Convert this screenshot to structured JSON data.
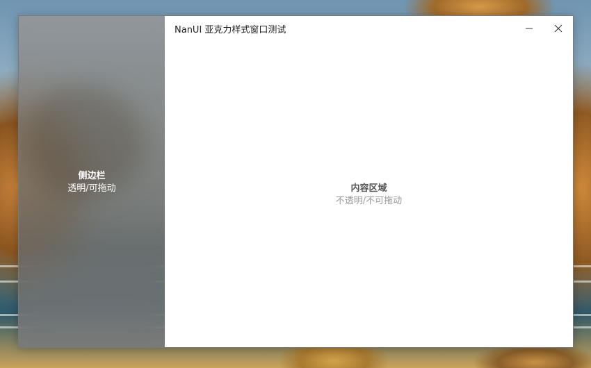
{
  "window": {
    "title": "NanUI 亚克力样式窗口测试",
    "minimize_icon": "minimize-icon",
    "close_icon": "close-icon"
  },
  "sidebar": {
    "title": "侧边栏",
    "subtitle": "透明/可拖动"
  },
  "content": {
    "title": "内容区域",
    "subtitle": "不透明/不可拖动"
  },
  "colors": {
    "sidebar_text": "#ffffff",
    "content_title": "#555555",
    "content_subtitle": "#999999",
    "content_bg": "#ffffff"
  }
}
